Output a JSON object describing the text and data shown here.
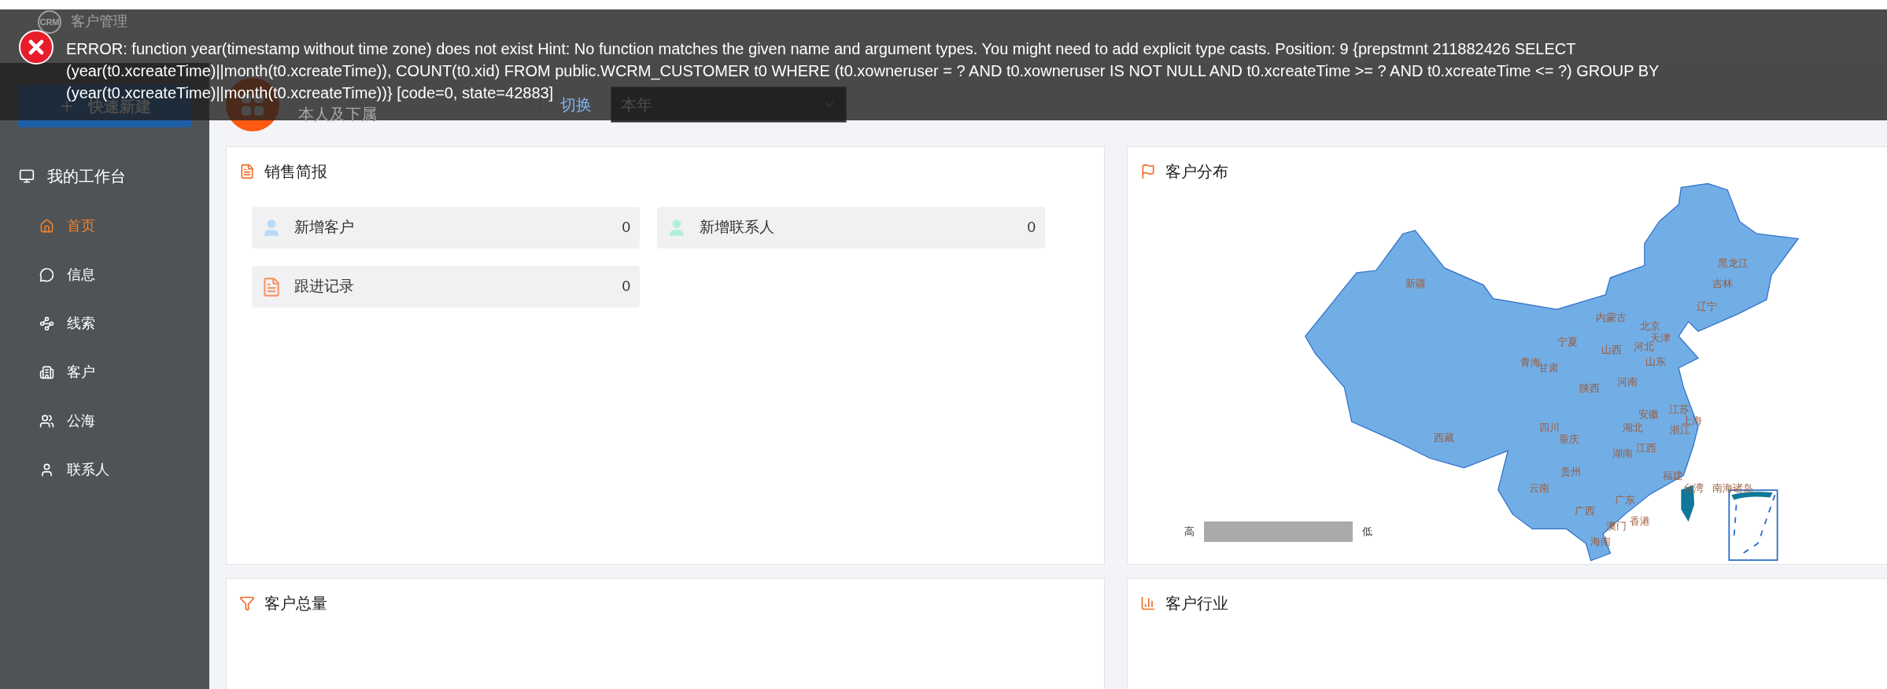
{
  "app": {
    "logo": "CRM",
    "title": "客户管理"
  },
  "sidebar": {
    "quick_create": "快速新建",
    "section": "我的工作台",
    "items": [
      {
        "label": "首页",
        "selected": true
      },
      {
        "label": "信息",
        "selected": false
      },
      {
        "label": "线索",
        "selected": false
      },
      {
        "label": "客户",
        "selected": false
      },
      {
        "label": "公海",
        "selected": false
      },
      {
        "label": "联系人",
        "selected": false
      }
    ]
  },
  "filter": {
    "scope": "本人及下属",
    "switch": "切换",
    "period": "本年"
  },
  "error": {
    "message": "ERROR: function year(timestamp without time zone) does not exist Hint: No function matches the given name and argument types. You might need to add explicit type casts. Position: 9 {prepstmnt 211882426 SELECT (year(t0.xcreateTime)||month(t0.xcreateTime)), COUNT(t0.xid) FROM public.WCRM_CUSTOMER t0 WHERE (t0.xowneruser = ? AND t0.xowneruser IS NOT NULL AND t0.xcreateTime >= ? AND t0.xcreateTime <= ?) GROUP BY (year(t0.xcreateTime)||month(t0.xcreateTime))} [code=0, state=42883]"
  },
  "sales_brief": {
    "title": "销售简报",
    "stats": [
      {
        "kind": "customer",
        "label": "新增客户",
        "value": "0"
      },
      {
        "kind": "contact",
        "label": "新增联系人",
        "value": "0"
      },
      {
        "kind": "record",
        "label": "跟进记录",
        "value": "0"
      }
    ]
  },
  "customer_distribution": {
    "title": "客户分布",
    "map_labels": [
      "新疆",
      "黑龙江",
      "吉林",
      "辽宁",
      "内蒙古",
      "北京",
      "天津",
      "宁夏",
      "山西",
      "河北",
      "青海",
      "甘肃",
      "山东",
      "河南",
      "陕西",
      "安徽",
      "江苏",
      "上海",
      "四川",
      "湖北",
      "浙江",
      "重庆",
      "西藏",
      "江西",
      "湖南",
      "贵州",
      "福建",
      "云南",
      "台湾",
      "南海诸岛",
      "广东",
      "广西",
      "澳门",
      "香港",
      "海南"
    ],
    "legend": {
      "high": "高",
      "low": "低"
    }
  },
  "customer_total": {
    "title": "客户总量"
  },
  "customer_industry": {
    "title": "客户行业"
  }
}
